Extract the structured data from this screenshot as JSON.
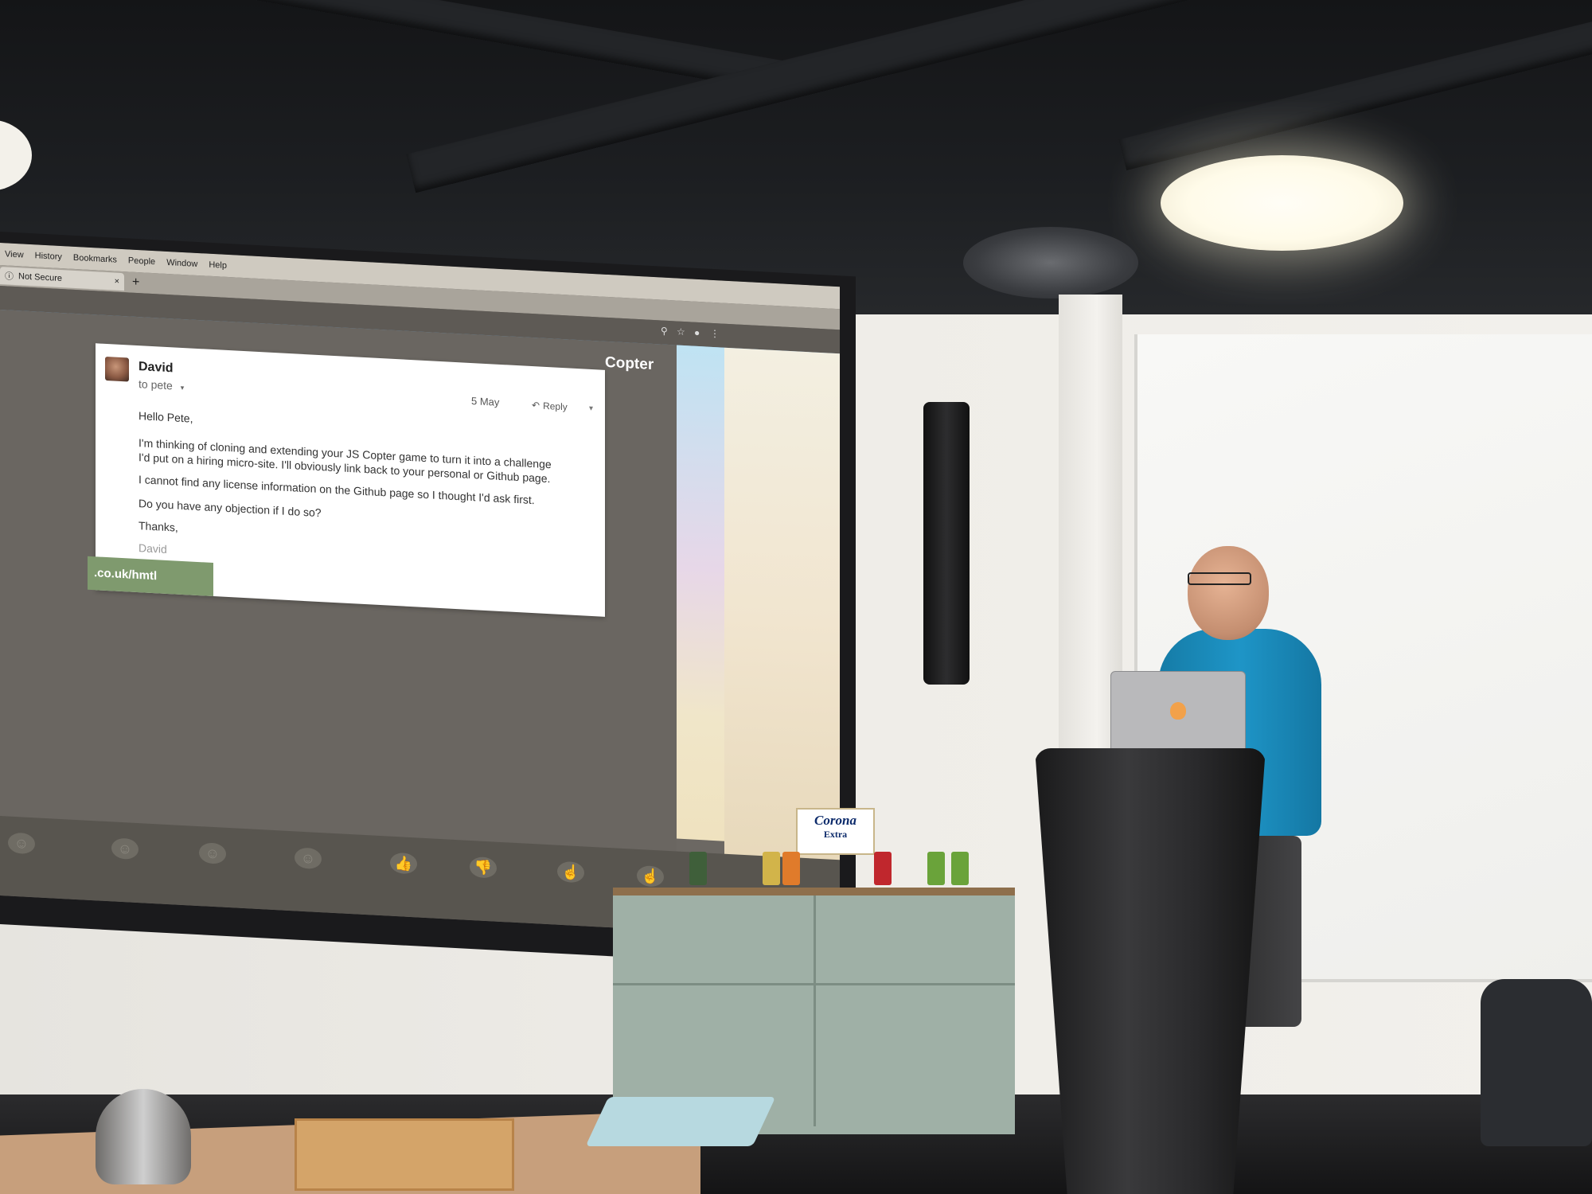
{
  "browser": {
    "menu_items": [
      "View",
      "History",
      "Bookmarks",
      "People",
      "Window",
      "Help"
    ],
    "tab_security_label": "Not Secure",
    "tab_close_glyph": "×",
    "new_tab_glyph": "+"
  },
  "game": {
    "title": "Copter"
  },
  "email": {
    "sender": "David",
    "recipient": "to pete",
    "date": "5 May",
    "reply_label": "Reply",
    "greeting": "Hello Pete,",
    "body_line_1": "I'm thinking of cloning and extending your JS Copter game to turn it into a challenge",
    "body_line_2": "I'd put on a hiring micro-site. I'll obviously link back to your personal or Github page.",
    "body_line_3": "I cannot find any license information on the Github page so I thought I'd ask first.",
    "body_line_4": "Do you have any objection if I do so?",
    "signoff": "Thanks,",
    "signature": "David"
  },
  "url_banner": ".co.uk/hmtl",
  "beer_box": {
    "brand": "Corona",
    "sub": "Extra"
  },
  "colors": {
    "presenter_shirt": "#1e95c7",
    "screen_game_bg": "#6a6661",
    "url_banner_bg": "#7f9a6e"
  }
}
